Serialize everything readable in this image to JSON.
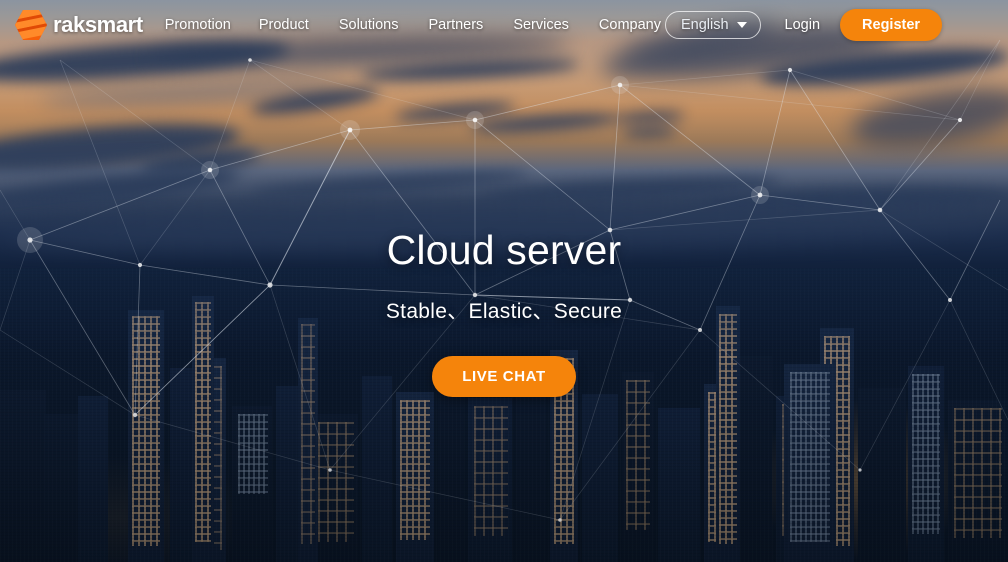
{
  "brand": {
    "name": "raksmart",
    "logo_icon": "raksmart-hex-logo-icon",
    "accent_color": "#f5840b"
  },
  "header": {
    "nav_items": [
      {
        "label": "Promotion"
      },
      {
        "label": "Product"
      },
      {
        "label": "Solutions"
      },
      {
        "label": "Partners"
      },
      {
        "label": "Services"
      },
      {
        "label": "Company"
      }
    ],
    "language": {
      "selected": "English",
      "caret_icon": "chevron-down-icon"
    },
    "login_label": "Login",
    "register_label": "Register"
  },
  "hero": {
    "title": "Cloud server",
    "subtitle": "Stable、Elastic、Secure",
    "cta_label": "LIVE CHAT",
    "background": {
      "description": "night city skyline under a sunset sky with a white network mesh overlay",
      "sky_color": "#c9a283",
      "cloud_color": "#2b3d5c",
      "city_color": "#0a1729",
      "mesh_color": "#e8eef6"
    }
  }
}
